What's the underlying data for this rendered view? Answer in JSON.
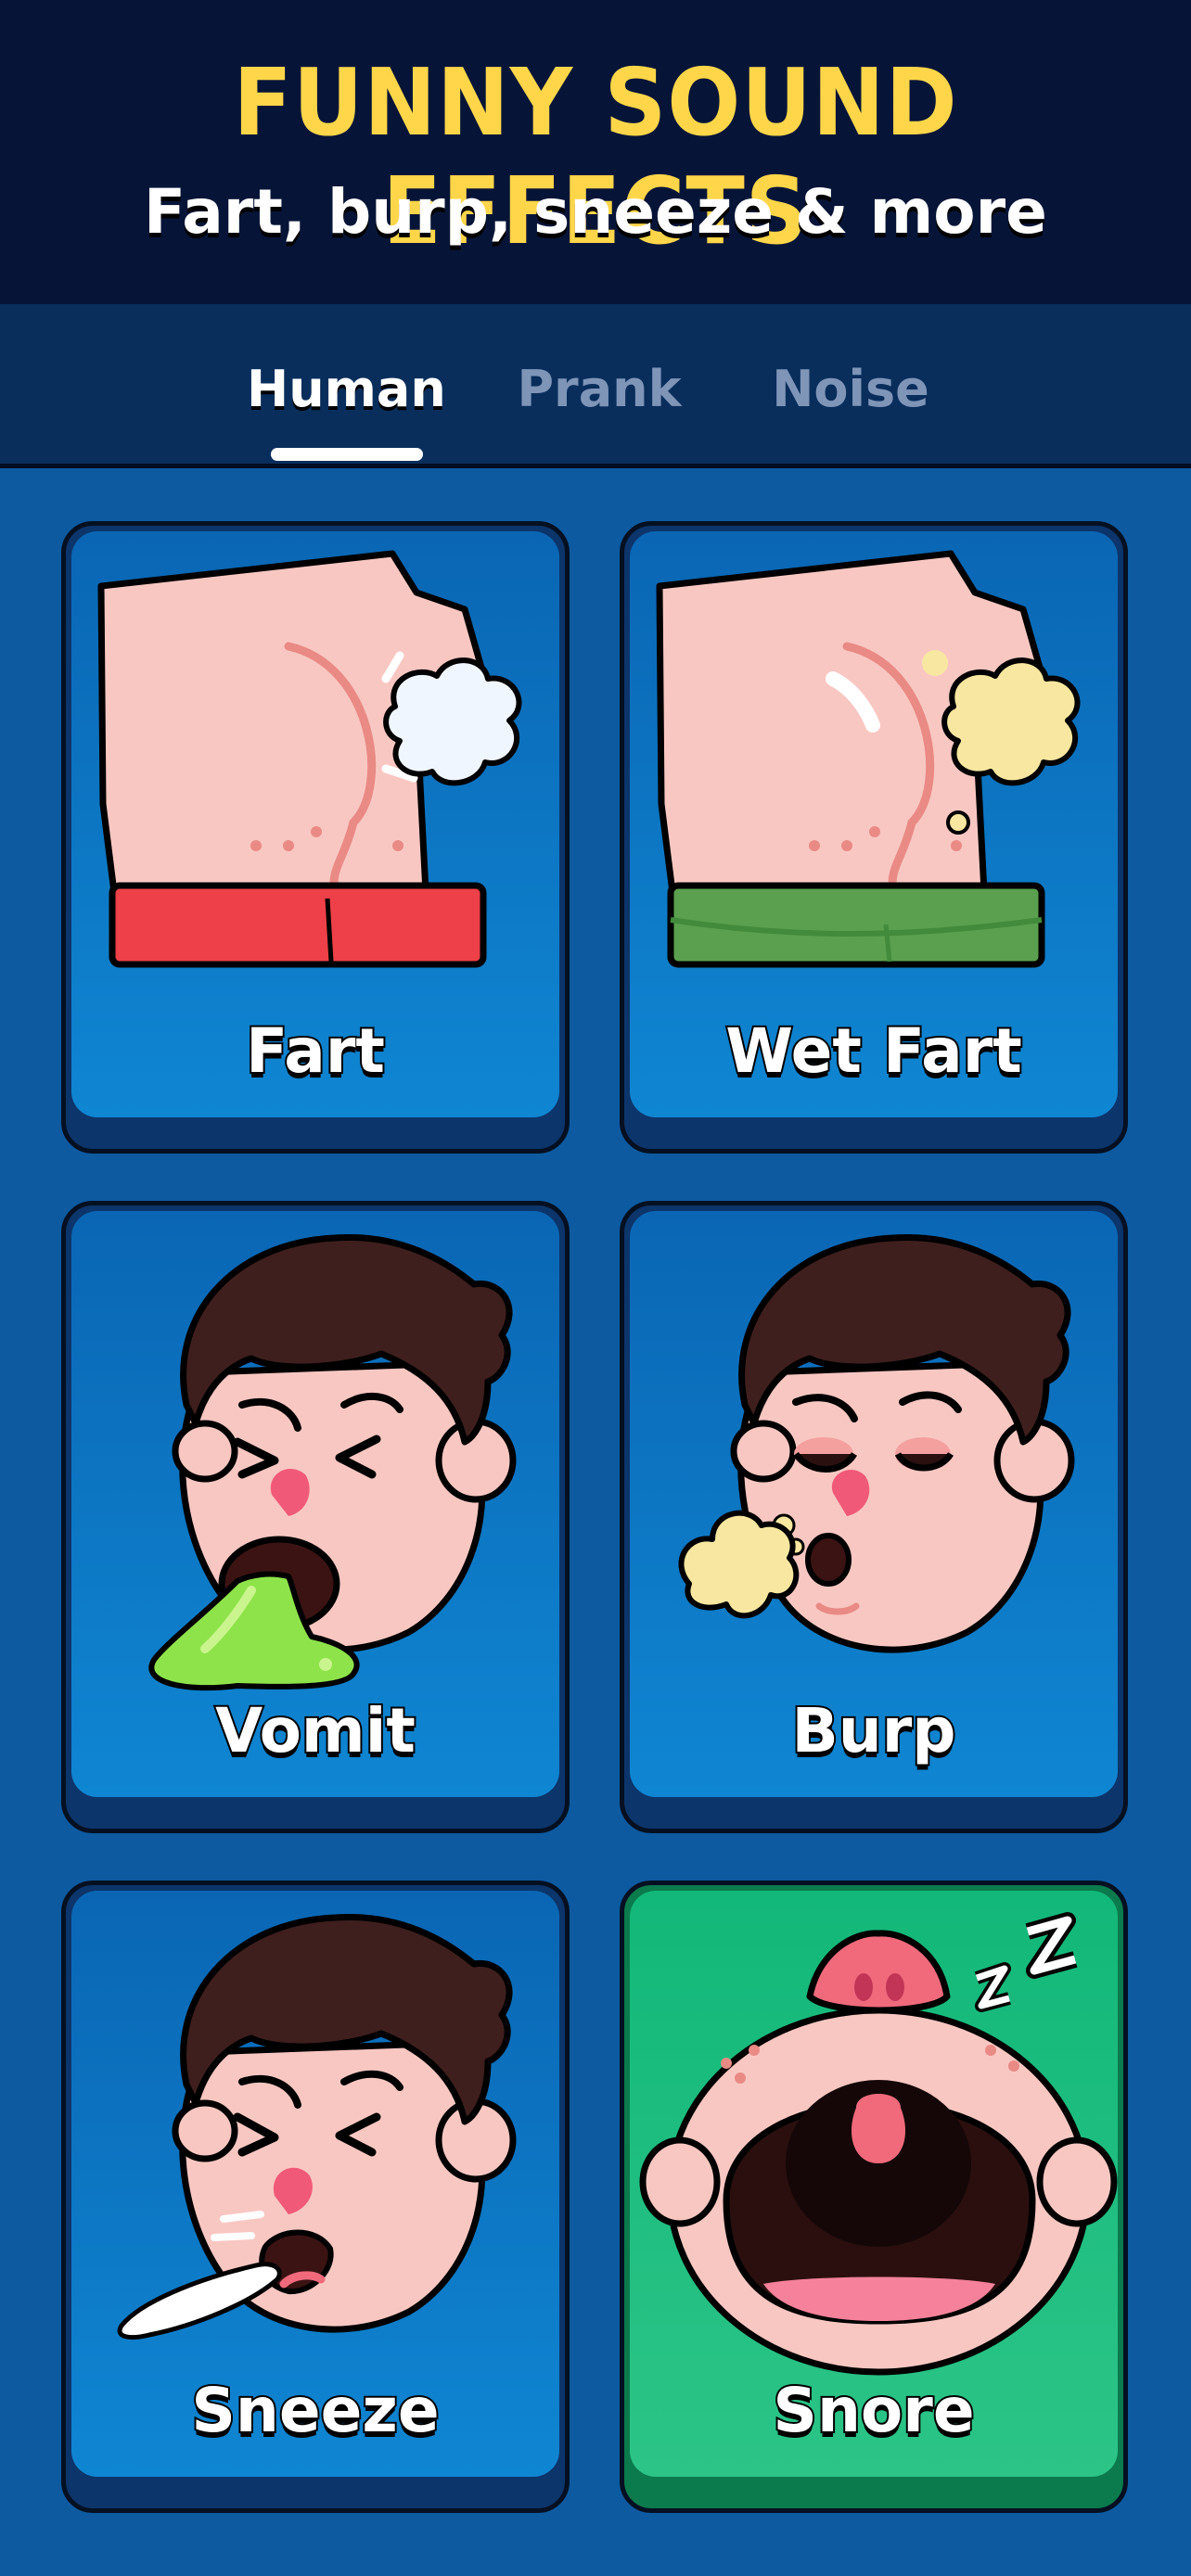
{
  "header": {
    "title": "FUNNY SOUND EFFECTS",
    "subtitle": "Fart, burp, sneeze & more"
  },
  "tabs": [
    {
      "label": "Human",
      "active": true
    },
    {
      "label": "Prank",
      "active": false
    },
    {
      "label": "Noise",
      "active": false
    }
  ],
  "sounds": [
    {
      "label": "Fart",
      "icon": "butt-cloud-icon",
      "highlighted": false
    },
    {
      "label": "Wet Fart",
      "icon": "butt-wet-cloud-icon",
      "highlighted": false
    },
    {
      "label": "Vomit",
      "icon": "vomit-face-icon",
      "highlighted": false
    },
    {
      "label": "Burp",
      "icon": "burp-face-icon",
      "highlighted": false
    },
    {
      "label": "Sneeze",
      "icon": "sneeze-face-icon",
      "highlighted": false
    },
    {
      "label": "Snore",
      "icon": "snore-baby-icon",
      "highlighted": true
    }
  ],
  "colors": {
    "header_bg": "#061537",
    "title": "#ffd64a",
    "card_blue": "#0f86d2",
    "card_green": "#2cc487",
    "page_bg": "#0d5aa0"
  }
}
